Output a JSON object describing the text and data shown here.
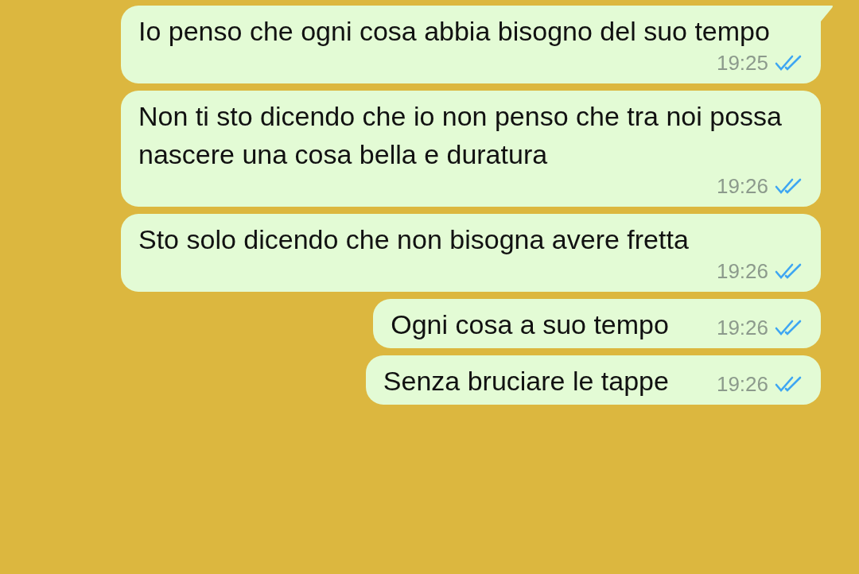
{
  "messages": [
    {
      "text": "Io penso che ogni cosa abbia bisogno del suo tempo",
      "time": "19:25",
      "read": true,
      "tail": true
    },
    {
      "text": "Non ti sto dicendo che io non penso che tra noi possa nascere una cosa bella e duratura",
      "time": "19:26",
      "read": true,
      "tail": false
    },
    {
      "text": "Sto solo dicendo che non bisogna avere fretta",
      "time": "19:26",
      "read": true,
      "tail": false
    },
    {
      "text": "Ogni cosa a suo tempo",
      "time": "19:26",
      "read": true,
      "tail": false
    },
    {
      "text": "Senza bruciare le tappe",
      "time": "19:26",
      "read": true,
      "tail": false
    }
  ]
}
